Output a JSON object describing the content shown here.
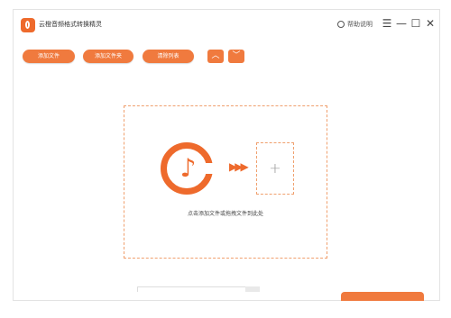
{
  "app": {
    "title": "云橙音频格式转换精灵"
  },
  "header": {
    "help_label": "帮助说明"
  },
  "window_controls": {
    "menu": "☰",
    "minimize": "—",
    "maximize": "☐",
    "close": "✕"
  },
  "toolbar": {
    "add_file": "添加文件",
    "add_folder": "添加文件夹",
    "clear_list": "清除列表",
    "move_up": "︿",
    "move_down": "﹀"
  },
  "dropzone": {
    "arrows": "▶▶▶",
    "plus": "+",
    "hint": "点击添加文件或拖拽文件到此处"
  },
  "colors": {
    "accent": "#ee6a2c",
    "button": "#f07a3e",
    "dashed_border": "#f0a06e"
  }
}
